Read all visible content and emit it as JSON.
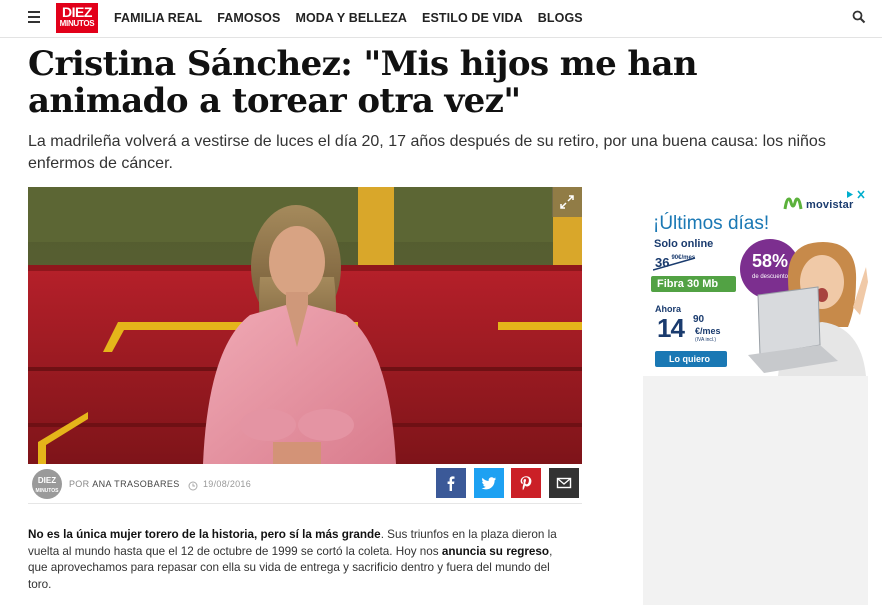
{
  "header": {
    "logo_top": "DIEZ",
    "logo_bottom": "MINUTOS",
    "nav": [
      "FAMILIA REAL",
      "FAMOSOS",
      "MODA Y BELLEZA",
      "ESTILO DE VIDA",
      "BLOGS"
    ],
    "icons": {
      "menu": "hamburger-icon",
      "search": "search-icon"
    }
  },
  "article": {
    "title": "Cristina Sánchez: \"Mis hijos me han animado a torear otra vez\"",
    "subtitle": "La madrileña volverá a vestirse de luces el día 20, 17 años después de su retiro, por una buena causa: los niños enfermos de cáncer.",
    "byline": {
      "avatar_text_1": "DIEZ",
      "avatar_text_2": "MINUTOS",
      "by_label": "POR",
      "author": "ANA TRASOBARES",
      "date": "19/08/2016"
    },
    "share_icons": [
      "facebook-icon",
      "twitter-icon",
      "pinterest-icon",
      "email-icon"
    ],
    "body": {
      "b1": "No es la única mujer torero de la historia, pero sí la más grande",
      "t1": ". Sus triunfos en la plaza dieron la vuelta al mundo hasta que el 12 de octubre de 1999 se cortó la coleta. Hoy nos ",
      "b2": "anuncia su regreso",
      "t2": ", que aprovechamos para repasar con ella su vida de entrega y sacrificio dentro y fuera del mundo del toro."
    }
  },
  "ad": {
    "brand": "movistar",
    "headline": "¡Últimos días!",
    "solo": "Solo online",
    "old_price": "36",
    "old_cents": "90€/mes",
    "badge_pct": "58%",
    "badge_text": "de descuento",
    "product": "Fibra 30 Mb",
    "ahora": "Ahora",
    "price": "14",
    "cents": "90",
    "per": "€/mes",
    "iva": "(IVA incl.)",
    "cta": "Lo quiero"
  },
  "colors": {
    "brand_red": "#e2001a",
    "facebook": "#3b5998",
    "twitter": "#1da1f2",
    "pinterest": "#cb2027",
    "email": "#333333"
  }
}
